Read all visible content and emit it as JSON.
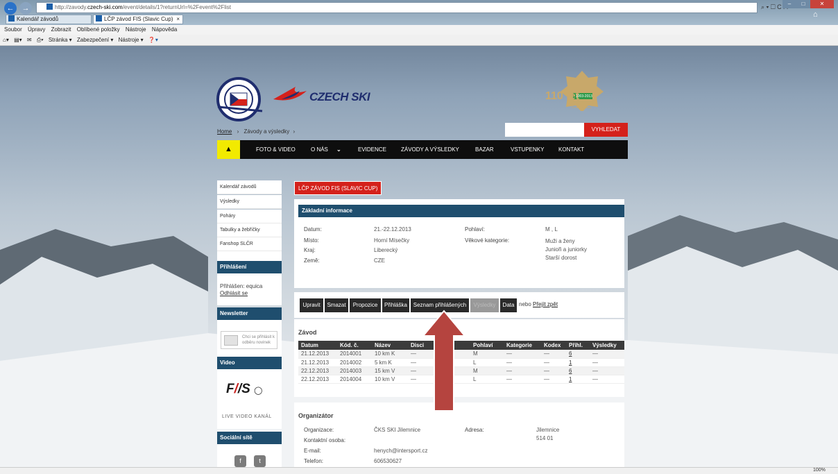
{
  "browser": {
    "url_prefix": "http://zavody.",
    "url_domain": "czech-ski.com",
    "url_path": "/event/details/1?returnUrl=%2Fevent%2Flist",
    "search_controls": "⌕ ▾ ☐ C ✕",
    "tabs": [
      {
        "label": "Kalendář závodů"
      },
      {
        "label": "LČP závod FIS (Slavic Cup)"
      }
    ],
    "menu": [
      "Soubor",
      "Úpravy",
      "Zobrazit",
      "Oblíbené položky",
      "Nástroje",
      "Nápověda"
    ],
    "command_bar": [
      "Stránka ▾",
      "Zabezpečení ▾",
      "Nástroje ▾"
    ],
    "zoom": "100%"
  },
  "header": {
    "logo_text": "CZECH SKI",
    "anniversary_text": "110 let",
    "anniversary_sub": "Svaz lyžařů",
    "anniversary_sub2": "České republiky",
    "anniversary_years": "1903-2013",
    "search_button": "VYHLEDAT"
  },
  "breadcrumb": {
    "home": "Home",
    "sep": "›",
    "current": "Závody a výsledky"
  },
  "nav": {
    "items": [
      "FOTO & VIDEO",
      "O NÁS",
      "EVIDENCE",
      "ZÁVODY A VÝSLEDKY",
      "BAZAR",
      "VSTUPENKY",
      "KONTAKT"
    ],
    "dropdown_glyph": "⌄"
  },
  "sidebar": {
    "items": [
      "Kalendář závodů",
      "Výsledky",
      "Poháry",
      "Tabulky a žebříčky",
      "Fanshop SLČR"
    ],
    "login_title": "Přihlášení",
    "login_text": "Přihlášen: equica",
    "logout": "Odhlásit se",
    "newsletter_title": "Newsletter",
    "newsletter_text": "Chci se přihlásit k odběru novinek",
    "video_title": "Video",
    "fis_caption": "LIVE VIDEO KANÁL",
    "social_title": "Sociální sítě",
    "social_f": "f",
    "social_t": "t"
  },
  "event": {
    "title": "LČP ZÁVOD FIS (SLAVIC CUP)",
    "basic_info_title": "Základní informace",
    "labels": {
      "date": "Datum:",
      "place": "Místo:",
      "region": "Kraj:",
      "country": "Země:",
      "gender": "Pohlaví:",
      "age_cat": "Věkové kategorie:"
    },
    "values": {
      "date": "21.-22.12.2013",
      "place": "Horní Mísečky",
      "region": "Liberecký",
      "country": "CZE",
      "gender": "M , L",
      "age_cat_1": "Muži a ženy",
      "age_cat_2": "Junioři a juniorky",
      "age_cat_3": "Starší dorost"
    }
  },
  "actions": {
    "buttons": [
      "Upravit",
      "Smazat",
      "Propozice",
      "Přihláška",
      "Seznam přihlášených",
      "Výsledky",
      "Data"
    ],
    "or_text": "nebo",
    "back_link": "Přejít zpět"
  },
  "race": {
    "title": "Závod",
    "headers": [
      "Datum",
      "Kód. č.",
      "Název",
      "Disci",
      "",
      "Pohlaví",
      "Kategorie",
      "Kodex",
      "Přihl.",
      "Výsledky"
    ],
    "rows": [
      [
        "21.12.2013",
        "2014001",
        "10 km K",
        "—",
        "",
        "M",
        "—",
        "—",
        "6",
        "—"
      ],
      [
        "21.12.2013",
        "2014002",
        "5 km K",
        "—",
        "",
        "L",
        "—",
        "—",
        "1",
        "—"
      ],
      [
        "22.12.2013",
        "2014003",
        "15 km V",
        "—",
        "",
        "M",
        "—",
        "—",
        "6",
        "—"
      ],
      [
        "22.12.2013",
        "2014004",
        "10 km V",
        "—",
        "",
        "L",
        "—",
        "—",
        "1",
        "—"
      ]
    ]
  },
  "organizer": {
    "title": "Organizátor",
    "labels": {
      "org": "Organizace:",
      "contact": "Kontaktní osoba:",
      "email": "E-mail:",
      "phone": "Telefon:",
      "address": "Adresa:"
    },
    "values": {
      "org": "ČKS SKI Jilemnice",
      "email": "henych@intersport.cz",
      "phone": "606530627",
      "address_1": "Jilemnice",
      "address_2": "514 01"
    }
  },
  "colors": {
    "accent_red": "#d4211b",
    "panel_blue": "#1f4e6e",
    "nav_black": "#0e0e0e",
    "home_yellow": "#f2ea00",
    "arrow_red": "#b5443f"
  }
}
